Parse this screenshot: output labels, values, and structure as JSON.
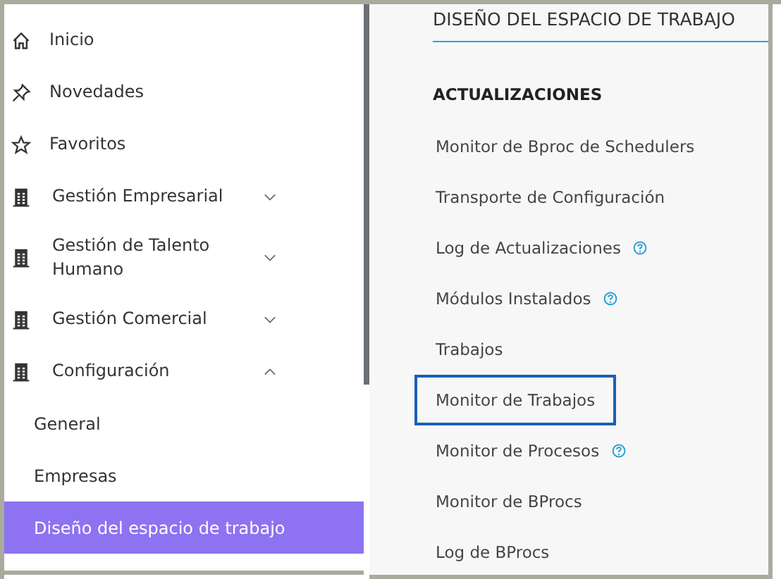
{
  "sidebar": {
    "items": [
      {
        "label": "Inicio",
        "kind": "home"
      },
      {
        "label": "Novedades",
        "kind": "pin"
      },
      {
        "label": "Favoritos",
        "kind": "star"
      },
      {
        "label": "Gestión Empresarial",
        "kind": "group",
        "expanded": false
      },
      {
        "label": "Gestión de Talento Humano",
        "kind": "group",
        "expanded": false
      },
      {
        "label": "Gestión Comercial",
        "kind": "group",
        "expanded": false
      },
      {
        "label": "Configuración",
        "kind": "group",
        "expanded": true,
        "children": [
          {
            "label": "General",
            "selected": false
          },
          {
            "label": "Empresas",
            "selected": false
          },
          {
            "label": "Diseño del espacio de trabajo",
            "selected": true
          }
        ]
      }
    ]
  },
  "panel": {
    "title": "DISEÑO DEL ESPACIO DE TRABAJO",
    "section": "ACTUALIZACIONES",
    "links": [
      {
        "label": "Monitor de Bproc de Schedulers",
        "help": false,
        "selected": false
      },
      {
        "label": "Transporte de Configuración",
        "help": false,
        "selected": false
      },
      {
        "label": "Log de Actualizaciones",
        "help": true,
        "selected": false
      },
      {
        "label": "Módulos Instalados",
        "help": true,
        "selected": false
      },
      {
        "label": "Trabajos",
        "help": false,
        "selected": false
      },
      {
        "label": "Monitor de Trabajos",
        "help": false,
        "selected": true
      },
      {
        "label": "Monitor de Procesos",
        "help": true,
        "selected": false
      },
      {
        "label": "Monitor de BProcs",
        "help": false,
        "selected": false
      },
      {
        "label": "Log de BProcs",
        "help": false,
        "selected": false
      }
    ]
  }
}
